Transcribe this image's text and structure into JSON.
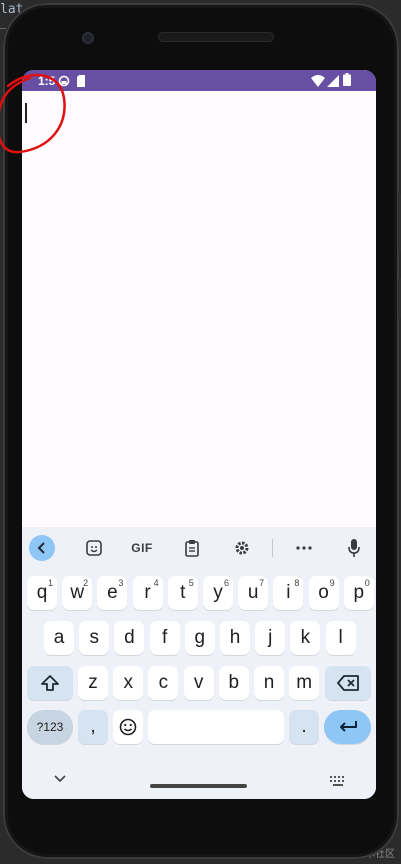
{
  "ide": {
    "text": "lat",
    "watermark": "@稀土掘金技术社区"
  },
  "status_bar": {
    "time": "1:5",
    "icons": [
      "gear-icon",
      "sd-card-icon",
      "wifi-icon",
      "signal-icon",
      "battery-icon"
    ]
  },
  "keyboard": {
    "toolbar": {
      "gif_label": "GIF"
    },
    "row1": [
      {
        "k": "q",
        "n": "1"
      },
      {
        "k": "w",
        "n": "2"
      },
      {
        "k": "e",
        "n": "3"
      },
      {
        "k": "r",
        "n": "4"
      },
      {
        "k": "t",
        "n": "5"
      },
      {
        "k": "y",
        "n": "6"
      },
      {
        "k": "u",
        "n": "7"
      },
      {
        "k": "i",
        "n": "8"
      },
      {
        "k": "o",
        "n": "9"
      },
      {
        "k": "p",
        "n": "0"
      }
    ],
    "row2": [
      "a",
      "s",
      "d",
      "f",
      "g",
      "h",
      "j",
      "k",
      "l"
    ],
    "row3": [
      "z",
      "x",
      "c",
      "v",
      "b",
      "n",
      "m"
    ],
    "sym_label": "?123",
    "comma": ",",
    "period": "."
  },
  "colors": {
    "accent": "#6750a4",
    "key_blue": "#8ec6f6",
    "annotation": "#e01010"
  }
}
